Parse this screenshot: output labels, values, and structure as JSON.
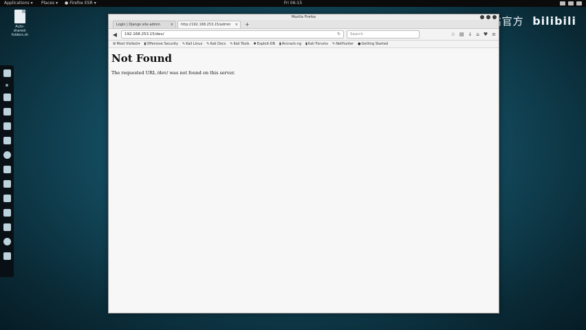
{
  "topbar": {
    "applications": "Applications",
    "places": "Places",
    "firefox": "Firefox ESR",
    "clock": "Fri 06:15"
  },
  "desktop": {
    "icon_label": "Auto-shared-folders.sh"
  },
  "watermark": {
    "cn": "站官方",
    "logo": "bilibili"
  },
  "window": {
    "title": "Mozilla Firefox",
    "tabs": [
      {
        "label": "Login | Django site admin"
      },
      {
        "label": "http://192.168.253.15/admin"
      }
    ],
    "url": "192.168.253.15/dev/",
    "search_placeholder": "Search",
    "bookmarks": [
      {
        "label": "Most Visited",
        "icon": "gear-icon"
      },
      {
        "label": "Offensive Security",
        "icon": "bookmark-icon"
      },
      {
        "label": "Kali Linux",
        "icon": "kali-icon"
      },
      {
        "label": "Kali Docs",
        "icon": "kali-icon"
      },
      {
        "label": "Kali Tools",
        "icon": "kali-icon"
      },
      {
        "label": "Exploit-DB",
        "icon": "exploit-icon"
      },
      {
        "label": "Aircrack-ng",
        "icon": "bookmark-icon"
      },
      {
        "label": "Kali Forums",
        "icon": "bookmark-icon"
      },
      {
        "label": "NetHunter",
        "icon": "kali-icon"
      },
      {
        "label": "Getting Started",
        "icon": "firefox-icon"
      }
    ]
  },
  "page": {
    "heading": "Not Found",
    "message": "The requested URL /dev/ was not found on this server."
  }
}
